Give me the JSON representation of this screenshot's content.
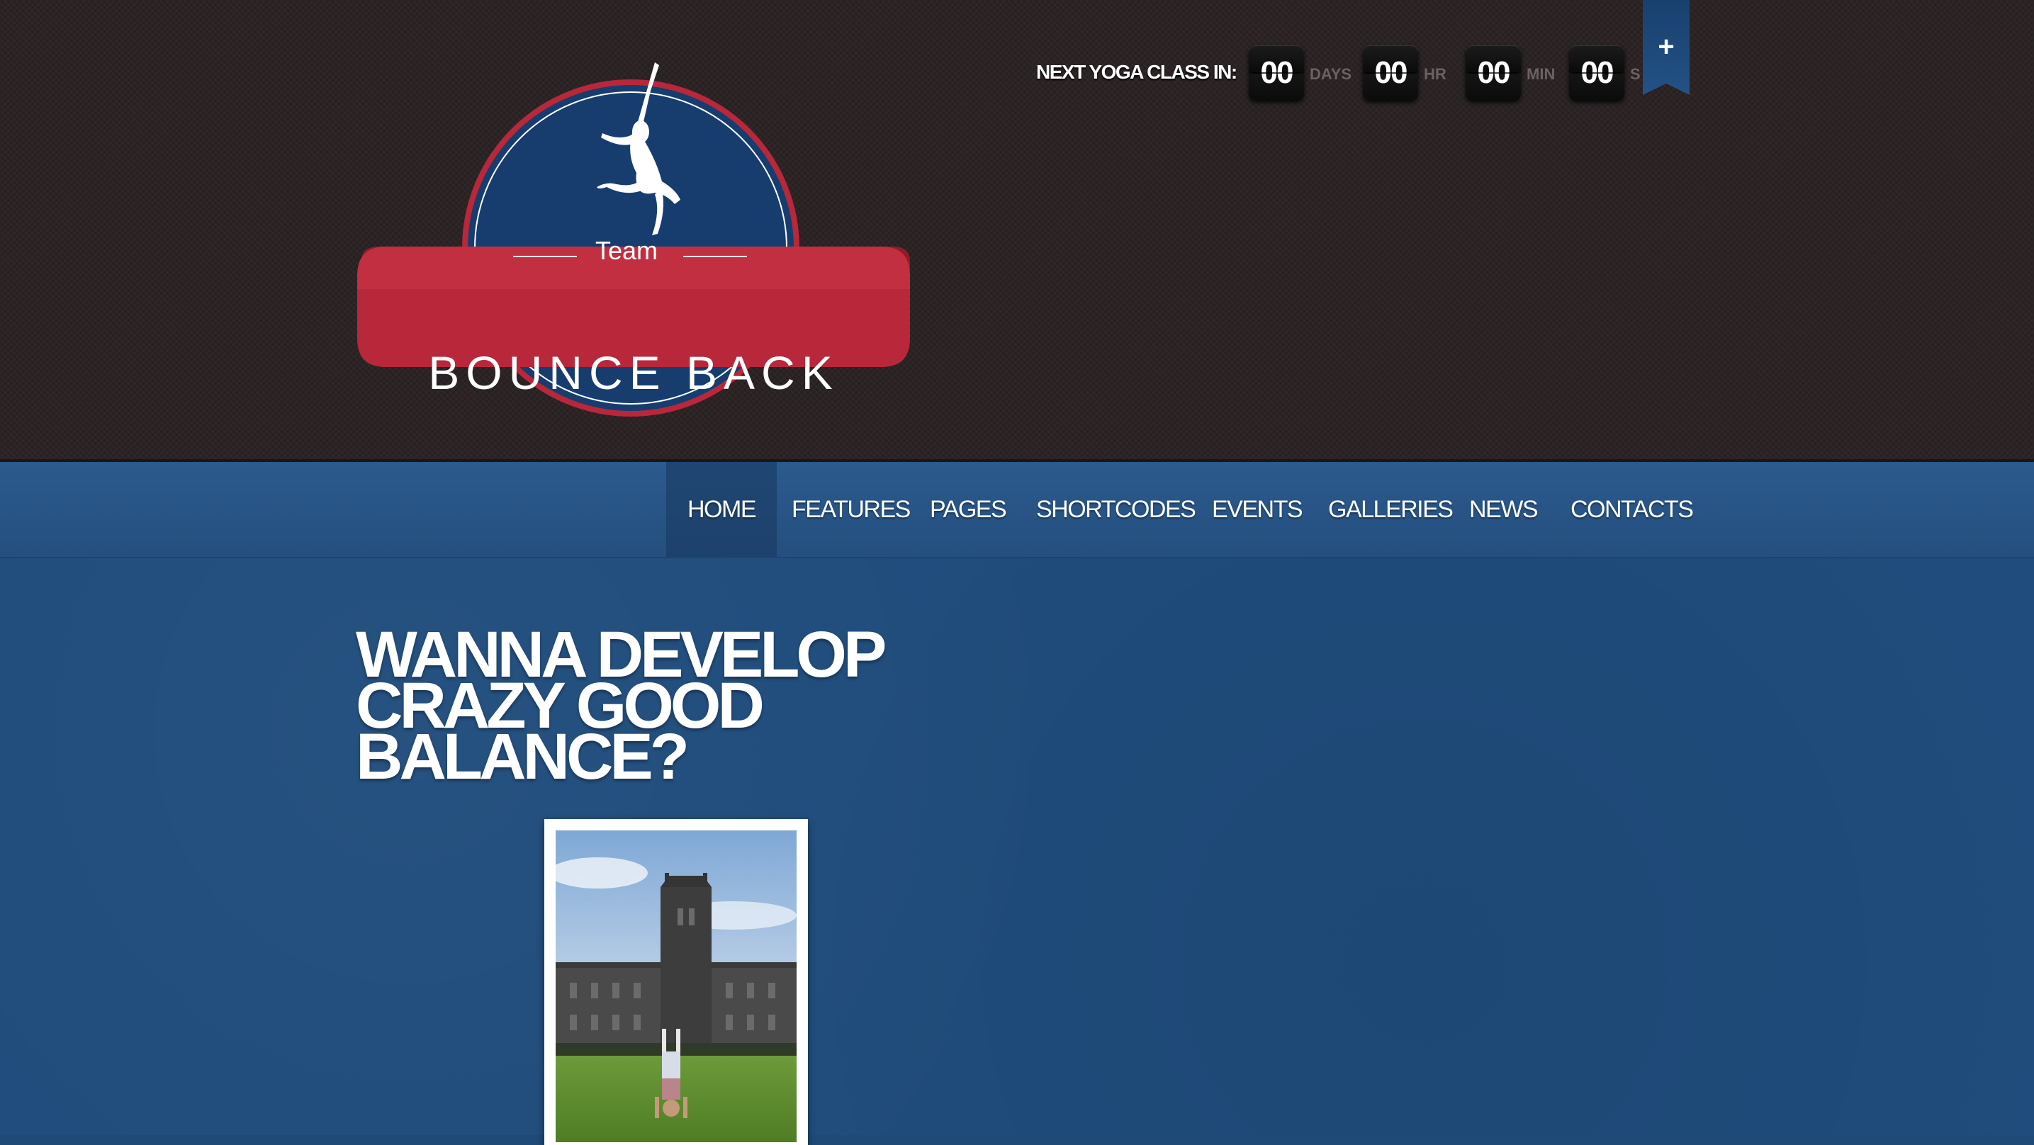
{
  "countdown": {
    "label": "NEXT YOGA CLASS IN:",
    "days": "00",
    "days_unit": "DAYS",
    "hours": "00",
    "hours_unit": "HR",
    "minutes": "00",
    "minutes_unit": "MIN",
    "seconds": "00",
    "seconds_unit": "S"
  },
  "ribbon": {
    "icon": "plus-icon",
    "symbol": "+"
  },
  "logo": {
    "top_text": "Team",
    "name": "BOUNCE BACK"
  },
  "nav": {
    "items": [
      "HOME",
      "FEATURES",
      "PAGES",
      "SHORTCODES",
      "EVENTS",
      "GALLERIES",
      "NEWS",
      "CONTACTS"
    ],
    "active": "HOME"
  },
  "content": {
    "headline_lines": [
      "WANNA DEVELOP",
      "CRAZY GOOD",
      "BALANCE?"
    ]
  },
  "colors": {
    "header_bg": "#2b2324",
    "nav_bg": "#2c5a8d",
    "content_bg": "#1f4c7c",
    "logo_blue": "#163d6e",
    "logo_red": "#b8273a"
  }
}
